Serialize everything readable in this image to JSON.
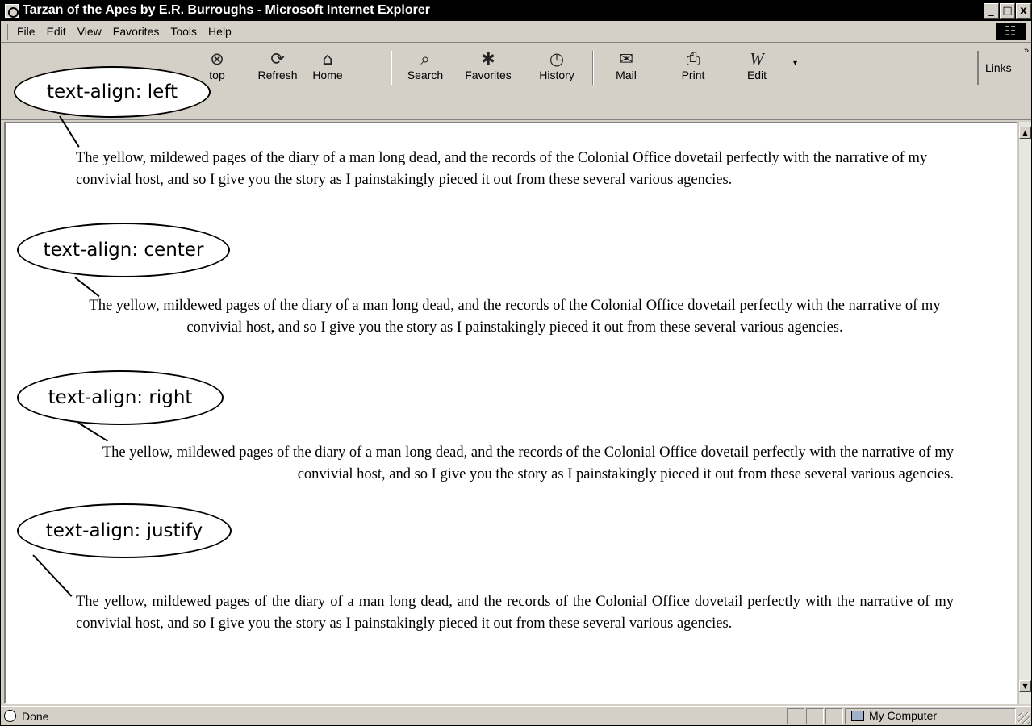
{
  "window": {
    "title": "Tarzan of the Apes by E.R. Burroughs - Microsoft Internet Explorer",
    "minimize_glyph": "_",
    "maximize_glyph": "□",
    "close_glyph": "x"
  },
  "menu": {
    "items": [
      "File",
      "Edit",
      "View",
      "Favorites",
      "Tools",
      "Help"
    ]
  },
  "toolbar": {
    "buttons": [
      {
        "label": "Stop",
        "visible_label": "top",
        "icon": "stop-icon",
        "glyph": "⊗"
      },
      {
        "label": "Refresh",
        "icon": "refresh-icon",
        "glyph": "⟳"
      },
      {
        "label": "Home",
        "icon": "home-icon",
        "glyph": "⌂"
      },
      {
        "label": "Search",
        "icon": "search-icon",
        "glyph": "⌕"
      },
      {
        "label": "Favorites",
        "icon": "favorites-icon",
        "glyph": "✱"
      },
      {
        "label": "History",
        "icon": "history-icon",
        "glyph": "◷"
      },
      {
        "label": "Mail",
        "icon": "mail-icon",
        "glyph": "✉"
      },
      {
        "label": "Print",
        "icon": "print-icon",
        "glyph": "⎙"
      },
      {
        "label": "Edit",
        "icon": "edit-icon",
        "glyph": "W"
      }
    ],
    "dropdown_glyph": "▾",
    "links_label": "Links",
    "links_chevron": "»"
  },
  "content": {
    "paragraph": "The yellow, mildewed pages of the diary of a man long dead, and the records of the Colonial Office dovetail perfectly with the narrative of my convivial host, and so I give you the story as I painstakingly pieced it out from these several various agencies.",
    "callouts": [
      {
        "label": "text-align: left",
        "align": "left"
      },
      {
        "label": "text-align: center",
        "align": "center"
      },
      {
        "label": "text-align: right",
        "align": "right"
      },
      {
        "label": "text-align: justify",
        "align": "justify"
      }
    ]
  },
  "scrollbar": {
    "up": "▲",
    "down": "▼"
  },
  "status": {
    "text": "Done",
    "zone": "My Computer"
  },
  "colors": {
    "chrome": "#d4d0c8",
    "titlebar": "#000000",
    "content_bg": "#ffffff"
  }
}
